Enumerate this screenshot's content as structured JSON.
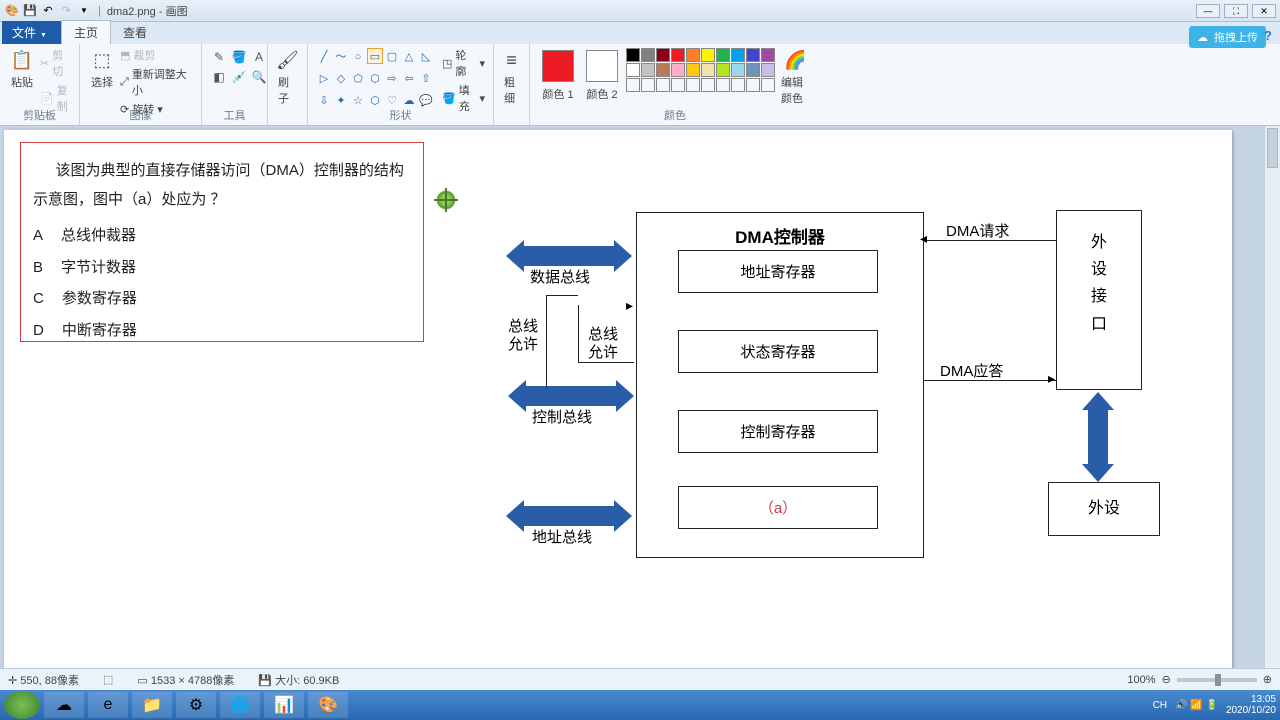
{
  "titlebar": {
    "filename": "dma2.png",
    "appname": "画图"
  },
  "tabs": {
    "file": "文件",
    "home": "主页",
    "view": "查看"
  },
  "ribbon": {
    "clipboard": {
      "paste": "粘贴",
      "cut": "剪切",
      "copy": "复制",
      "label": "剪贴板"
    },
    "image": {
      "select": "选择",
      "crop": "裁剪",
      "resize": "重新调整大小",
      "rotate": "旋转",
      "label": "图像"
    },
    "tools": {
      "label": "工具"
    },
    "brush": {
      "label": "刷子"
    },
    "shapes": {
      "outline": "轮廓",
      "fill": "填充",
      "label": "形状"
    },
    "size": {
      "label": "粗细"
    },
    "colors": {
      "c1": "颜色 1",
      "c2": "颜色 2",
      "edit": "编辑颜色",
      "label": "颜色"
    }
  },
  "cloud": {
    "label": "拖拽上传"
  },
  "question": {
    "text": "该图为典型的直接存储器访问（DMA）控制器的结构示意图，图中（a）处应为 ？",
    "A": "总线仲裁器",
    "B": "字节计数器",
    "C": "参数寄存器",
    "D": "中断寄存器"
  },
  "diagram": {
    "title": "DMA控制器",
    "reg1": "地址寄存器",
    "reg2": "状态寄存器",
    "reg3": "控制寄存器",
    "reg4": "（a）",
    "bus1": "数据总线",
    "bus2": "控制总线",
    "bus3": "地址总线",
    "allow1": "总线允许",
    "allow2": "总线允许",
    "req": "DMA请求",
    "ack": "DMA应答",
    "iface": "外设接口",
    "dev": "外设"
  },
  "status": {
    "pos": "550, 88像素",
    "dim": "1533 × 4788像素",
    "size": "大小: 60.9KB",
    "zoom": "100%"
  },
  "tray": {
    "lang": "CH",
    "time": "13:05",
    "date": "2020/10/20"
  }
}
